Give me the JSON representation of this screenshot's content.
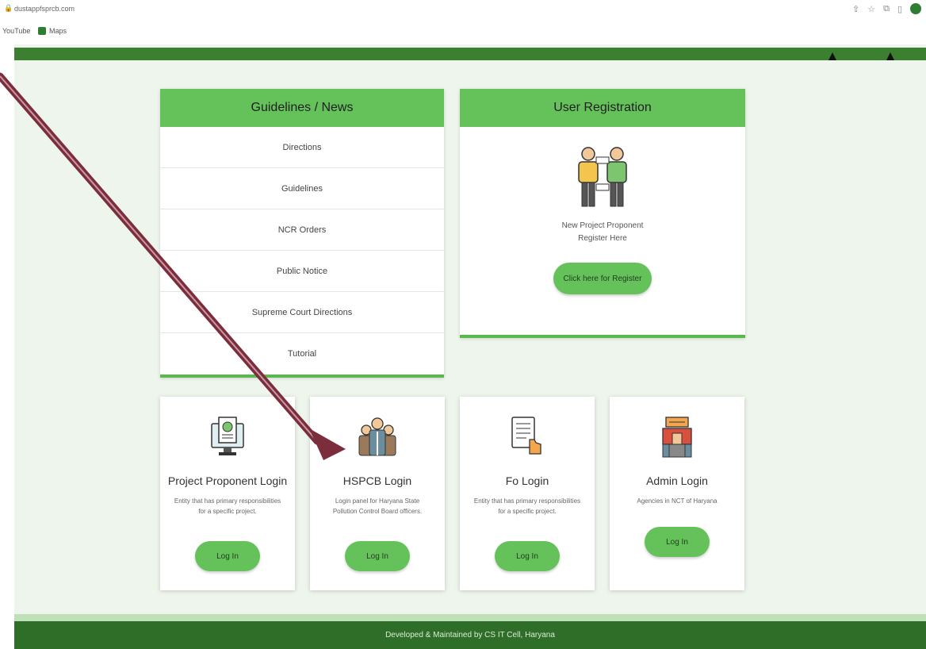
{
  "browser": {
    "url": "dustappfsprcb.com",
    "bookmarks": [
      "YouTube",
      "Maps"
    ]
  },
  "news": {
    "title": "Guidelines / News",
    "items": [
      "Directions",
      "Guidelines",
      "NCR Orders",
      "Public Notice",
      "Supreme Court Directions",
      "Tutorial"
    ]
  },
  "registration": {
    "title": "User Registration",
    "text_line1": "New Project Proponent",
    "text_line2": "Register Here",
    "button": "Click here for Register"
  },
  "logins": [
    {
      "title": "Project Proponent Login",
      "desc_line1": "Entity that has primary responsibilities",
      "desc_line2": "for a specific project.",
      "button": "Log In"
    },
    {
      "title": "HSPCB Login",
      "desc_line1": "Login panel for Haryana State",
      "desc_line2": "Pollution Control Board officers.",
      "button": "Log In"
    },
    {
      "title": "Fo Login",
      "desc_line1": "Entity that has primary responsibilities",
      "desc_line2": "for a specific project.",
      "button": "Log In"
    },
    {
      "title": "Admin Login",
      "desc_line1": "Agencies in NCT of Haryana",
      "desc_line2": "",
      "button": "Log In"
    }
  ],
  "footer": "Developed & Maintained by CS IT Cell, Haryana",
  "colors": {
    "accent": "#65c25b",
    "dark_green": "#2e6e28",
    "arrow": "#7b2d3c"
  }
}
